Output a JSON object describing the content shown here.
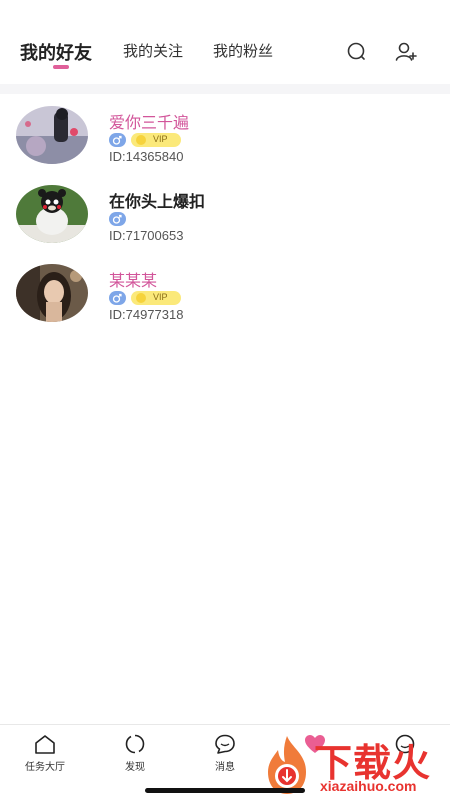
{
  "header": {
    "tabs": [
      {
        "label": "我的好友",
        "active": true
      },
      {
        "label": "我的关注",
        "active": false
      },
      {
        "label": "我的粉丝",
        "active": false
      }
    ],
    "icons": [
      "search-icon",
      "add-user-icon"
    ],
    "accent_color": "#e0609a"
  },
  "friends": [
    {
      "name": "爱你三千遍",
      "gender": "male",
      "vip": true,
      "vip_label": "VIP",
      "id_text": "ID:14365840"
    },
    {
      "name": "在你头上爆扣",
      "gender": "male",
      "vip": false,
      "id_text": "ID:71700653"
    },
    {
      "name": "某某某",
      "gender": "male",
      "vip": true,
      "vip_label": "VIP",
      "id_text": "ID:74977318"
    }
  ],
  "tabbar": {
    "items": [
      {
        "label": "任务大厅",
        "icon": "home-icon"
      },
      {
        "label": "发现",
        "icon": "discover-icon"
      },
      {
        "label": "消息",
        "icon": "message-icon"
      },
      {
        "label": "",
        "icon": "heart-icon"
      },
      {
        "label": "",
        "icon": "profile-icon"
      }
    ]
  },
  "watermark": {
    "title": "下载火",
    "subtitle": "xiazaihuo.com"
  },
  "colors": {
    "vip_name": "#d2559a",
    "gender_badge": "#7ea6e8",
    "vip_badge": "#fbe97a"
  }
}
